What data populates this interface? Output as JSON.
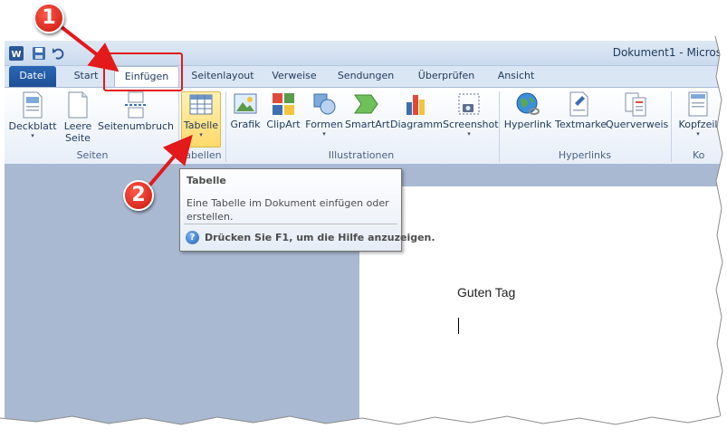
{
  "window": {
    "title": "Dokument1 - Micros"
  },
  "tabs": [
    {
      "label": "Datei"
    },
    {
      "label": "Start"
    },
    {
      "label": "Einfügen"
    },
    {
      "label": "Seitenlayout"
    },
    {
      "label": "Verweise"
    },
    {
      "label": "Sendungen"
    },
    {
      "label": "Überprüfen"
    },
    {
      "label": "Ansicht"
    }
  ],
  "ribbon": {
    "groups": {
      "seiten": "Seiten",
      "tabellen": "Tabellen",
      "illustrationen": "Illustrationen",
      "hyperlinks": "Hyperlinks",
      "kopf": "Ko"
    },
    "buttons": {
      "deckblatt": "Deckblatt",
      "leere_seite_1": "Leere",
      "leere_seite_2": "Seite",
      "seitenumbruch": "Seitenumbruch",
      "tabelle": "Tabelle",
      "grafik": "Grafik",
      "clipart": "ClipArt",
      "formen": "Formen",
      "smartart": "SmartArt",
      "diagramm": "Diagramm",
      "screenshot": "Screenshot",
      "hyperlink": "Hyperlink",
      "textmarke": "Textmarke",
      "querverweis": "Querverweis",
      "kopfzeile": "Kopfzeil"
    },
    "dropdown_arrow": "▾"
  },
  "tooltip": {
    "title": "Tabelle",
    "body": "Eine Tabelle im Dokument einfügen oder erstellen.",
    "help_icon": "?",
    "help": "Drücken Sie F1, um die Hilfe anzuzeigen."
  },
  "document": {
    "text": "Guten Tag"
  },
  "callouts": {
    "one": "1",
    "two": "2"
  },
  "colors": {
    "callout_red": "#e3191b",
    "file_tab_blue": "#2a67b6",
    "workspace": "#a9b9d1"
  }
}
